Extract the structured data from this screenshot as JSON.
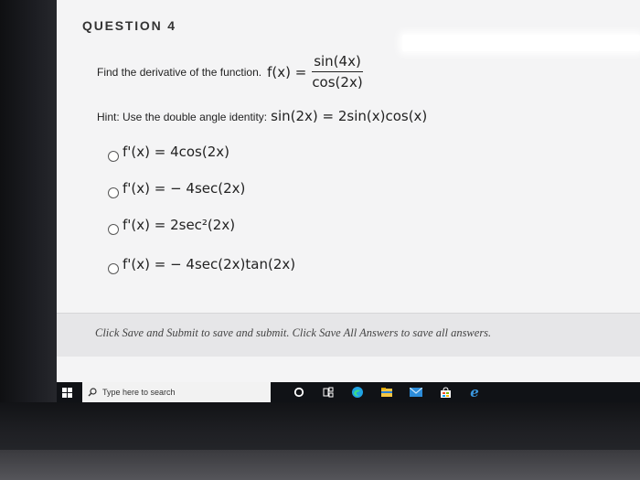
{
  "question": {
    "title": "QUESTION 4",
    "prompt": "Find the derivative of the function.",
    "function_lhs": "f(x) =",
    "numerator": "sin(4x)",
    "denominator": "cos(2x)"
  },
  "hint": {
    "label": "Hint: Use the double angle identity:",
    "identity": "sin(2x) = 2sin(x)cos(x)"
  },
  "options": [
    {
      "label": "f'(x) = 4cos(2x)"
    },
    {
      "label": "f'(x) = − 4sec(2x)"
    },
    {
      "label": "f'(x) = 2sec²(2x)"
    },
    {
      "label": "f'(x) = − 4sec(2x)tan(2x)"
    }
  ],
  "footer": {
    "instructions": "Click Save and Submit to save and submit. Click Save All Answers to save all answers."
  },
  "taskbar": {
    "search_placeholder": "Type here to search",
    "icons": [
      "windows-start-icon",
      "cortana-icon",
      "task-view-icon",
      "edge-chromium-icon",
      "file-explorer-icon",
      "mail-icon",
      "store-icon",
      "edge-legacy-icon"
    ]
  }
}
